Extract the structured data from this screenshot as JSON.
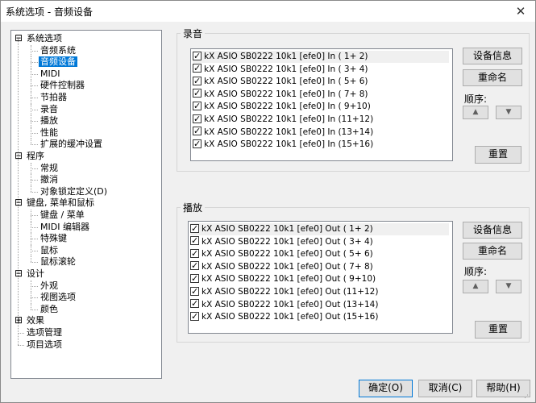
{
  "window": {
    "title": "系统选项 - 音频设备",
    "close_glyph": "✕"
  },
  "tree": {
    "items": [
      {
        "label": "系统选项",
        "level": 0,
        "expander": "⊟"
      },
      {
        "label": "音频系统",
        "level": 1
      },
      {
        "label": "音频设备",
        "level": 1,
        "selected": true
      },
      {
        "label": "MIDI",
        "level": 1
      },
      {
        "label": "硬件控制器",
        "level": 1
      },
      {
        "label": "节拍器",
        "level": 1
      },
      {
        "label": "录音",
        "level": 1
      },
      {
        "label": "播放",
        "level": 1
      },
      {
        "label": "性能",
        "level": 1
      },
      {
        "label": "扩展的缓冲设置",
        "level": 1
      },
      {
        "label": "程序",
        "level": 0,
        "expander": "⊟"
      },
      {
        "label": "常规",
        "level": 1
      },
      {
        "label": "撤消",
        "level": 1
      },
      {
        "label": "对象锁定定义(D)",
        "level": 1
      },
      {
        "label": "键盘, 菜单和鼠标",
        "level": 0,
        "expander": "⊟"
      },
      {
        "label": "键盘 / 菜单",
        "level": 1
      },
      {
        "label": "MIDI 编辑器",
        "level": 1
      },
      {
        "label": "特殊键",
        "level": 1
      },
      {
        "label": "鼠标",
        "level": 1
      },
      {
        "label": "鼠标滚轮",
        "level": 1
      },
      {
        "label": "设计",
        "level": 0,
        "expander": "⊟"
      },
      {
        "label": "外观",
        "level": 1
      },
      {
        "label": "视图选项",
        "level": 1
      },
      {
        "label": "颜色",
        "level": 1
      },
      {
        "label": "效果",
        "level": 0,
        "expander": "⊞"
      },
      {
        "label": "选项管理",
        "level": 0
      },
      {
        "label": "项目选项",
        "level": 0
      }
    ]
  },
  "record": {
    "title": "录音",
    "devices": [
      "kX ASIO SB0222 10k1 [efe0] In ( 1+ 2)",
      "kX ASIO SB0222 10k1 [efe0] In ( 3+ 4)",
      "kX ASIO SB0222 10k1 [efe0] In ( 5+ 6)",
      "kX ASIO SB0222 10k1 [efe0] In ( 7+ 8)",
      "kX ASIO SB0222 10k1 [efe0] In ( 9+10)",
      "kX ASIO SB0222 10k1 [efe0] In (11+12)",
      "kX ASIO SB0222 10k1 [efe0] In (13+14)",
      "kX ASIO SB0222 10k1 [efe0] In (15+16)"
    ],
    "info_label": "设备信息",
    "rename_label": "重命名",
    "order_label": "顺序:",
    "up_glyph": "▲",
    "down_glyph": "▼",
    "reset_label": "重置"
  },
  "playback": {
    "title": "播放",
    "devices": [
      "kX ASIO SB0222 10k1 [efe0] Out ( 1+ 2)",
      "kX ASIO SB0222 10k1 [efe0] Out ( 3+ 4)",
      "kX ASIO SB0222 10k1 [efe0] Out ( 5+ 6)",
      "kX ASIO SB0222 10k1 [efe0] Out ( 7+ 8)",
      "kX ASIO SB0222 10k1 [efe0] Out ( 9+10)",
      "kX ASIO SB0222 10k1 [efe0] Out (11+12)",
      "kX ASIO SB0222 10k1 [efe0] Out (13+14)",
      "kX ASIO SB0222 10k1 [efe0] Out (15+16)"
    ],
    "info_label": "设备信息",
    "rename_label": "重命名",
    "order_label": "顺序:",
    "up_glyph": "▲",
    "down_glyph": "▼",
    "reset_label": "重置"
  },
  "footer": {
    "ok_label": "确定(O)",
    "cancel_label": "取消(C)",
    "help_label": "帮助(H)"
  }
}
